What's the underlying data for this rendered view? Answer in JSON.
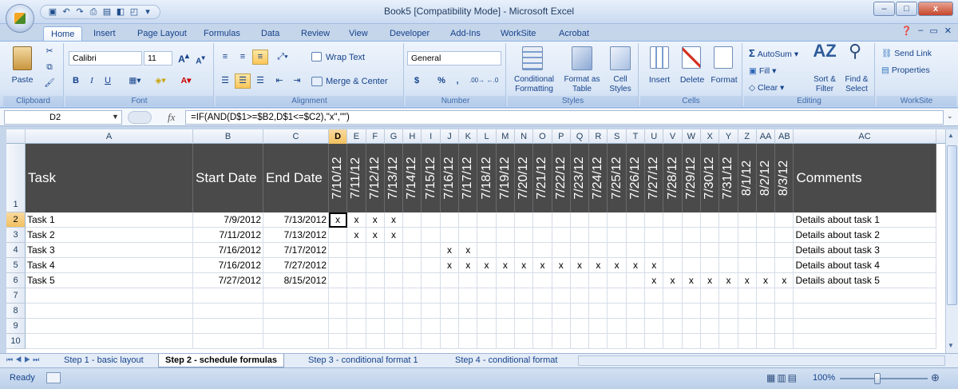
{
  "window": {
    "title": "Book5  [Compatibility Mode] - Microsoft Excel",
    "minimize": "–",
    "maximize": "□",
    "close": "x"
  },
  "ribbon_tabs": [
    "Home",
    "Insert",
    "Page Layout",
    "Formulas",
    "Data",
    "Review",
    "View",
    "Developer",
    "Add-Ins",
    "WorkSite",
    "Acrobat"
  ],
  "active_tab": "Home",
  "ribbon": {
    "clipboard": {
      "label": "Clipboard",
      "paste": "Paste"
    },
    "font": {
      "label": "Font",
      "name": "Calibri",
      "size": "11",
      "bold": "B",
      "italic": "I",
      "underline": "U"
    },
    "alignment": {
      "label": "Alignment",
      "wrap": "Wrap Text",
      "merge": "Merge & Center"
    },
    "number": {
      "label": "Number",
      "format": "General",
      "currency": "$",
      "percent": "%",
      "comma": ","
    },
    "styles": {
      "label": "Styles",
      "conditional": "Conditional Formatting",
      "format_table": "Format as Table",
      "cell_styles": "Cell Styles"
    },
    "cells": {
      "label": "Cells",
      "insert": "Insert",
      "delete": "Delete",
      "format": "Format"
    },
    "editing": {
      "label": "Editing",
      "autosum": "AutoSum",
      "fill": "Fill",
      "clear": "Clear",
      "sort": "Sort & Filter",
      "find": "Find & Select"
    },
    "worksite": {
      "label": "WorkSite",
      "send_link": "Send Link",
      "properties": "Properties"
    }
  },
  "formula_bar": {
    "name_box": "D2",
    "fx": "fx",
    "formula": "=IF(AND(D$1>=$B2,D$1<=$C2),\"x\",\"\")"
  },
  "columns": [
    "A",
    "B",
    "C",
    "D",
    "E",
    "F",
    "G",
    "H",
    "I",
    "J",
    "K",
    "L",
    "M",
    "N",
    "O",
    "P",
    "Q",
    "R",
    "S",
    "T",
    "U",
    "V",
    "W",
    "X",
    "Y",
    "Z",
    "AA",
    "AB",
    "AC"
  ],
  "selected_column": "D",
  "header_row": {
    "task": "Task",
    "start": "Start Date",
    "end": "End Date",
    "dates": [
      "7/10/12",
      "7/11/12",
      "7/12/12",
      "7/13/12",
      "7/14/12",
      "7/15/12",
      "7/16/12",
      "7/17/12",
      "7/18/12",
      "7/19/12",
      "7/20/12",
      "7/21/12",
      "7/22/12",
      "7/23/12",
      "7/24/12",
      "7/25/12",
      "7/26/12",
      "7/27/12",
      "7/28/12",
      "7/29/12",
      "7/30/12",
      "7/31/12",
      "8/1/12",
      "8/2/12",
      "8/3/12"
    ],
    "comments": "Comments"
  },
  "rows": [
    {
      "task": "Task 1",
      "start": "7/9/2012",
      "end": "7/13/2012",
      "marks": [
        "x",
        "x",
        "x",
        "x",
        "",
        "",
        "",
        "",
        "",
        "",
        "",
        "",
        "",
        "",
        "",
        "",
        "",
        "",
        "",
        "",
        "",
        "",
        "",
        "",
        ""
      ],
      "comment": "Details about task 1"
    },
    {
      "task": "Task 2",
      "start": "7/11/2012",
      "end": "7/13/2012",
      "marks": [
        "",
        "x",
        "x",
        "x",
        "",
        "",
        "",
        "",
        "",
        "",
        "",
        "",
        "",
        "",
        "",
        "",
        "",
        "",
        "",
        "",
        "",
        "",
        "",
        "",
        ""
      ],
      "comment": "Details about task 2"
    },
    {
      "task": "Task 3",
      "start": "7/16/2012",
      "end": "7/17/2012",
      "marks": [
        "",
        "",
        "",
        "",
        "",
        "",
        "x",
        "x",
        "",
        "",
        "",
        "",
        "",
        "",
        "",
        "",
        "",
        "",
        "",
        "",
        "",
        "",
        "",
        "",
        ""
      ],
      "comment": "Details about task 3"
    },
    {
      "task": "Task 4",
      "start": "7/16/2012",
      "end": "7/27/2012",
      "marks": [
        "",
        "",
        "",
        "",
        "",
        "",
        "x",
        "x",
        "x",
        "x",
        "x",
        "x",
        "x",
        "x",
        "x",
        "x",
        "x",
        "x",
        "",
        "",
        "",
        "",
        "",
        "",
        ""
      ],
      "comment": "Details about task 4"
    },
    {
      "task": "Task 5",
      "start": "7/27/2012",
      "end": "8/15/2012",
      "marks": [
        "",
        "",
        "",
        "",
        "",
        "",
        "",
        "",
        "",
        "",
        "",
        "",
        "",
        "",
        "",
        "",
        "",
        "x",
        "x",
        "x",
        "x",
        "x",
        "x",
        "x",
        "x"
      ],
      "comment": "Details about task 5"
    }
  ],
  "row_numbers": [
    "1",
    "2",
    "3",
    "4",
    "5",
    "6",
    "7",
    "8",
    "9",
    "10"
  ],
  "selected_row": "2",
  "sheet_tabs": [
    "Step 1 - basic layout",
    "Step 2 - schedule formulas",
    "Step 3 - conditional format 1",
    "Step 4 - conditional format"
  ],
  "active_sheet": "Step 2 - schedule formulas",
  "status": {
    "ready": "Ready",
    "zoom": "100%"
  }
}
